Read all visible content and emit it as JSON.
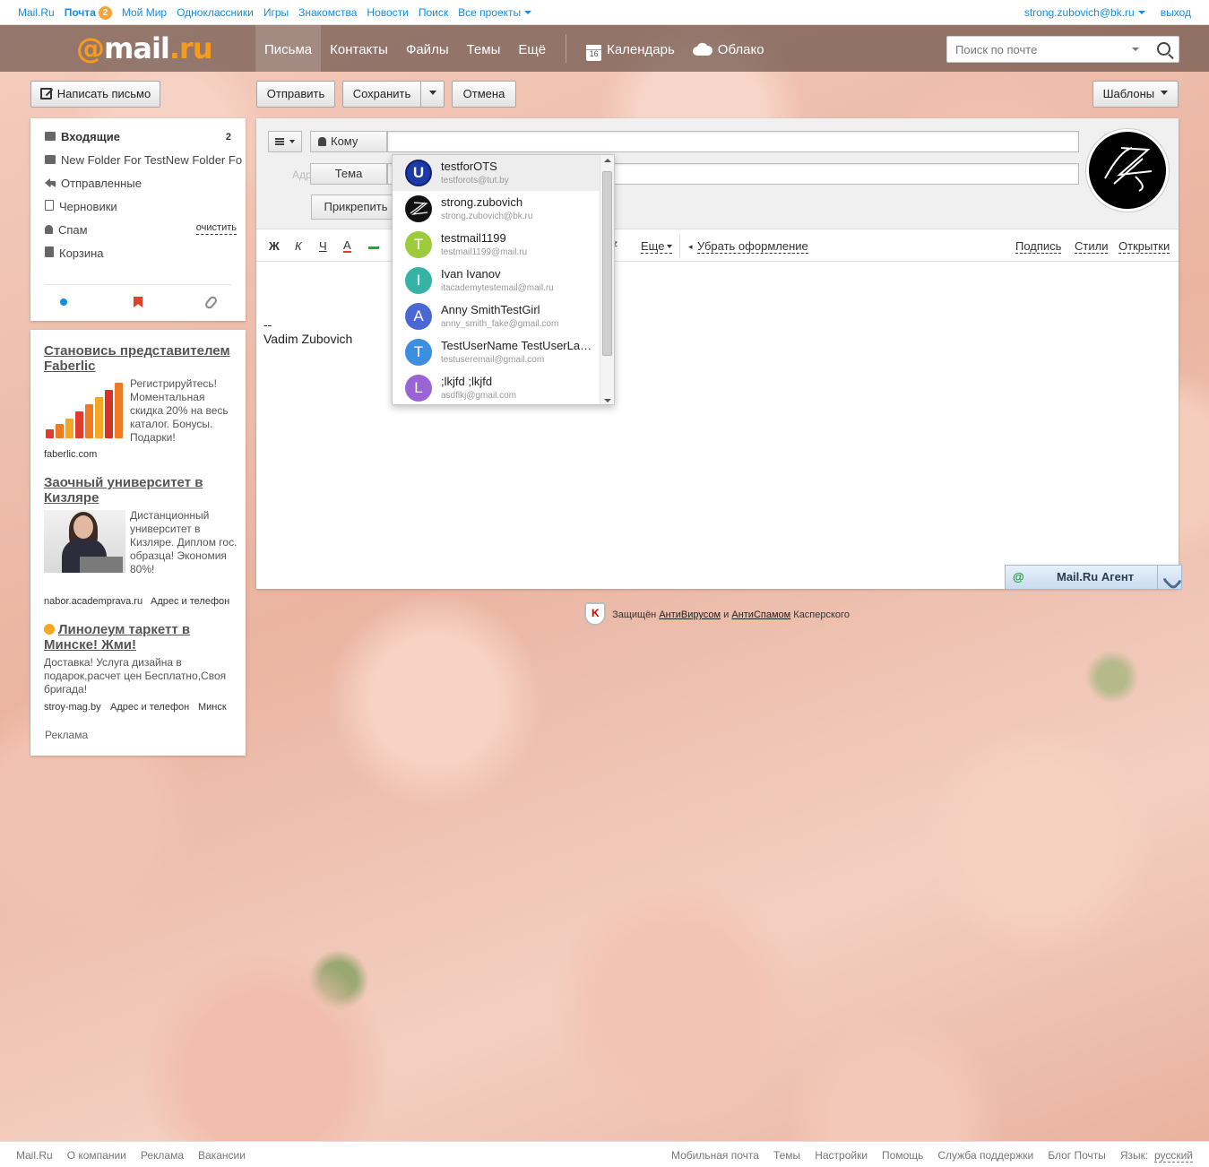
{
  "portal": {
    "links": [
      "Mail.Ru",
      "Почта",
      "Мой Мир",
      "Одноклассники",
      "Игры",
      "Знакомства",
      "Новости",
      "Поиск",
      "Все проекты"
    ],
    "mail_badge": "2",
    "user_email": "strong.zubovich@bk.ru",
    "logout": "выход"
  },
  "header": {
    "logo_at": "@",
    "logo_mail": "mail",
    "logo_dot": ".",
    "logo_ru": "ru",
    "nav": [
      "Письма",
      "Контакты",
      "Файлы",
      "Темы",
      "Ещё"
    ],
    "calendar_label": "Календарь",
    "calendar_day": "16",
    "cloud_label": "Облако",
    "search_placeholder": "Поиск по почте"
  },
  "actions": {
    "compose": "Написать письмо",
    "send": "Отправить",
    "save": "Сохранить",
    "cancel": "Отмена",
    "templates": "Шаблоны"
  },
  "folders": [
    {
      "name": "Входящие",
      "count": "2"
    },
    {
      "name": "New Folder For TestNew Folder For Test"
    },
    {
      "name": "Отправленные"
    },
    {
      "name": "Черновики"
    },
    {
      "name": "Спам",
      "action": "очистить"
    },
    {
      "name": "Корзина"
    }
  ],
  "ads": {
    "ad1": {
      "title": "Становись представителем Faberlic",
      "text": "Регистрируйтесь! Моментальная скидка 20% на весь каталог. Бонусы. Подарки!",
      "domain": "faberlic.com"
    },
    "ad2": {
      "title": "Заочный университет в Кизляре",
      "text": "Дистанционный университет в Кизляре. Диплом гос. образца! Экономия 80%!",
      "domain": "nabor.academprava.ru",
      "extra": "Адрес и телефон"
    },
    "ad3": {
      "title": "Линолеум таркетт в Минске! Жми!",
      "text": "Доставка! Услуга дизайна в подарок,расчет цен Бесплатно,Своя бригада!",
      "domain": "stroy-mag.by",
      "extra": "Адрес и телефон",
      "city": "Минск"
    },
    "label": "Реклама"
  },
  "compose": {
    "to_label": "Кому",
    "subject_label": "Тема",
    "attach_label": "Прикрепить",
    "addr_book": "Адресная книга",
    "toolbar": {
      "bold": "Ж",
      "italic": "К",
      "underline": "Ч",
      "color": "А",
      "more": "Еще",
      "clear": "Убрать оформление",
      "signature": "Подпись",
      "styles": "Стили",
      "cards": "Открытки"
    },
    "sig_dash": "--",
    "sig_name": "Vadim Zubovich"
  },
  "suggestions": [
    {
      "name": "testforOTS",
      "email": "testforots@tut.by",
      "initial": "U",
      "color": "#1c3aa8"
    },
    {
      "name": "strong.zubovich",
      "email": "strong.zubovich@bk.ru",
      "initial": "",
      "color": "#111111"
    },
    {
      "name": "testmail1199",
      "email": "testmail1199@mail.ru",
      "initial": "T",
      "color": "#9ccc3c"
    },
    {
      "name": "Ivan Ivanov",
      "email": "itacademytestemail@mail.ru",
      "initial": "I",
      "color": "#37b3a6"
    },
    {
      "name": "Anny SmithTestGirl",
      "email": "anny_smith_fake@gmail.com",
      "initial": "A",
      "color": "#4a67d6"
    },
    {
      "name": "TestUserName TestUserLastName",
      "email": "testuseremail@gmail.com",
      "initial": "T",
      "color": "#3b8ee0"
    },
    {
      "name": ";lkjfd ;lkjfd",
      "email": "asdflkj@gmail.com",
      "initial": "L",
      "color": "#9a63d6"
    }
  ],
  "kaspersky": {
    "prefix": "Защищён",
    "av": "АнтиВирусом",
    "and": "и",
    "as": "АнтиСпамом",
    "suffix": "Касперского"
  },
  "agent": {
    "at": "@",
    "label": "Mail.Ru Агент"
  },
  "footer": {
    "left": [
      "Mail.Ru",
      "О компании",
      "Реклама",
      "Вакансии"
    ],
    "right": [
      "Мобильная почта",
      "Темы",
      "Настройки",
      "Помощь",
      "Служба поддержки",
      "Блог Почты"
    ],
    "lang_label": "Язык:",
    "lang": "русский"
  }
}
